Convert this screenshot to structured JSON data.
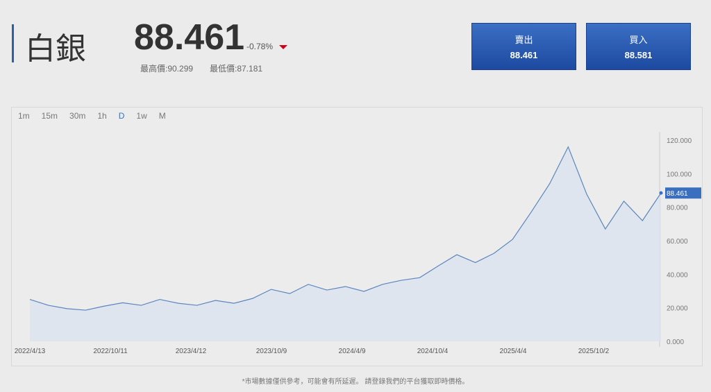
{
  "header": {
    "title": "白銀",
    "price": "88.461",
    "change": "-0.78%",
    "high": "最高價:90.299",
    "low": "最低價:87.181"
  },
  "buttons": {
    "sell_label": "賣出",
    "sell_price": "88.461",
    "buy_label": "買入",
    "buy_price": "88.581"
  },
  "timeframes": [
    "1m",
    "15m",
    "30m",
    "1h",
    "D",
    "1w",
    "M"
  ],
  "active_timeframe": "D",
  "colors": {
    "accent": "#3a6fc0",
    "down": "#d0021b"
  },
  "chart_data": {
    "type": "area",
    "ylim": [
      0,
      120
    ],
    "yticks": [
      "120.000",
      "100.000",
      "80.000",
      "60.000",
      "40.000",
      "20.000",
      "0.000"
    ],
    "xticks": [
      "2022/4/13",
      "2022/10/11",
      "2023/4/12",
      "2023/10/9",
      "2024/4/9",
      "2024/10/4",
      "2025/4/4",
      "2025/10/2"
    ],
    "last_label": "88.461",
    "values": [
      25,
      21.5,
      19.5,
      18.6,
      21,
      23,
      21.5,
      25,
      22.7,
      21.5,
      24.4,
      22.7,
      25.6,
      31,
      28.5,
      34,
      30.6,
      32.7,
      29.8,
      34,
      36.4,
      38,
      45,
      51.7,
      47,
      52.5,
      60.8,
      77,
      94,
      116,
      87.7,
      67,
      83.6,
      72,
      88.5
    ]
  },
  "footer": "*市場數據僅供參考，可能會有所延遲。 請登錄我們的平台獲取即時價格。"
}
